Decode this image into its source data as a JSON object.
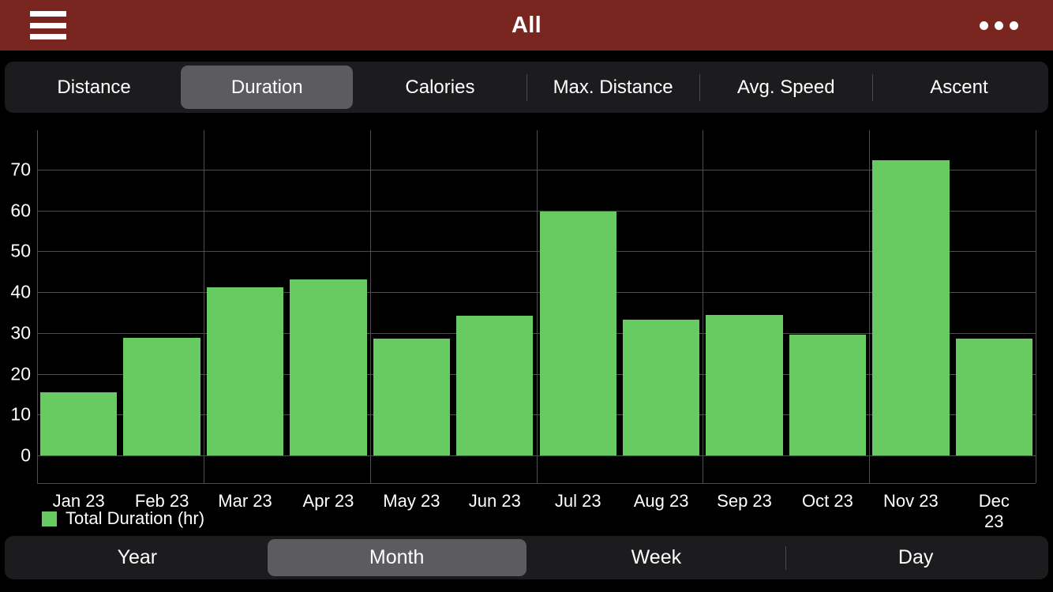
{
  "topbar": {
    "title": "All",
    "menu_icon": "hamburger-menu-icon",
    "overflow_icon": "more-options-icon"
  },
  "metric_tabs": [
    {
      "label": "Distance",
      "selected": false
    },
    {
      "label": "Duration",
      "selected": true
    },
    {
      "label": "Calories",
      "selected": false
    },
    {
      "label": "Max. Distance",
      "selected": false
    },
    {
      "label": "Avg. Speed",
      "selected": false
    },
    {
      "label": "Ascent",
      "selected": false
    }
  ],
  "period_tabs": [
    {
      "label": "Year",
      "selected": false
    },
    {
      "label": "Month",
      "selected": true
    },
    {
      "label": "Week",
      "selected": false
    },
    {
      "label": "Day",
      "selected": false
    }
  ],
  "colors": {
    "header": "#7a2620",
    "bar": "#68cb62",
    "selected_tab": "#5c5c60",
    "bar_background": "#000000",
    "grid": "#4e4e4e"
  },
  "legend": {
    "label": "Total Duration (hr)",
    "swatch_color": "#68cb62"
  },
  "chart_data": {
    "type": "bar",
    "title": "",
    "xlabel": "",
    "ylabel": "",
    "ylim": [
      0,
      75
    ],
    "ytick_values": [
      0,
      10,
      20,
      30,
      40,
      50,
      60,
      70
    ],
    "ytick_labels": [
      "0",
      "10",
      "20",
      "30",
      "40",
      "50",
      "60",
      "70"
    ],
    "grid": true,
    "legend_position": "bottom-left",
    "categories": [
      "Jan 23",
      "Feb 23",
      "Mar 23",
      "Apr 23",
      "May 23",
      "Jun 23",
      "Jul 23",
      "Aug 23",
      "Sep 23",
      "Oct 23",
      "Nov 23",
      "Dec 23"
    ],
    "series": [
      {
        "name": "Total Duration (hr)",
        "color": "#68cb62",
        "values": [
          15.5,
          28.9,
          41.2,
          43.2,
          28.6,
          34.3,
          59.8,
          33.3,
          34.5,
          29.6,
          72.3,
          28.6
        ]
      }
    ]
  }
}
